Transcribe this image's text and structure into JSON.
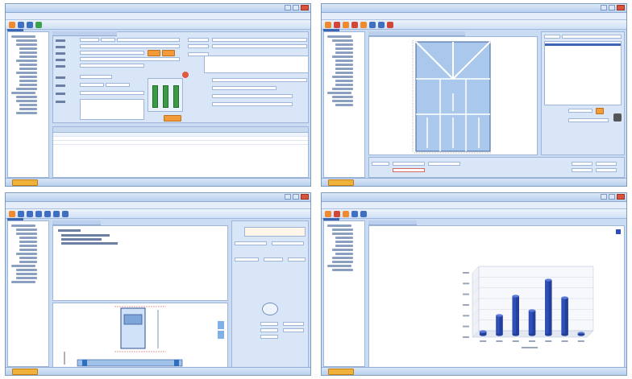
{
  "screens": [
    {
      "id": "form-view"
    },
    {
      "id": "panel-layout-view"
    },
    {
      "id": "schematic-view"
    },
    {
      "id": "chart-view"
    }
  ],
  "colors": {
    "window_bg": "#c9dcf4",
    "accent_orange": "#f08a2c",
    "bar_blue": "#2f4fb8",
    "indicator_green": "#3c9a44",
    "canvas_blue": "#a9c8ec"
  },
  "icons": [
    "orange-app-icon",
    "toolbar-icons",
    "tree-folder-icon",
    "start-button-icon"
  ],
  "chart_data": {
    "type": "bar",
    "categories": [
      "",
      "",
      "",
      "",
      "",
      "",
      ""
    ],
    "values": [
      10,
      60,
      120,
      75,
      170,
      115,
      5
    ],
    "ylim": [
      0,
      200
    ],
    "grid": true,
    "three_d": true
  }
}
